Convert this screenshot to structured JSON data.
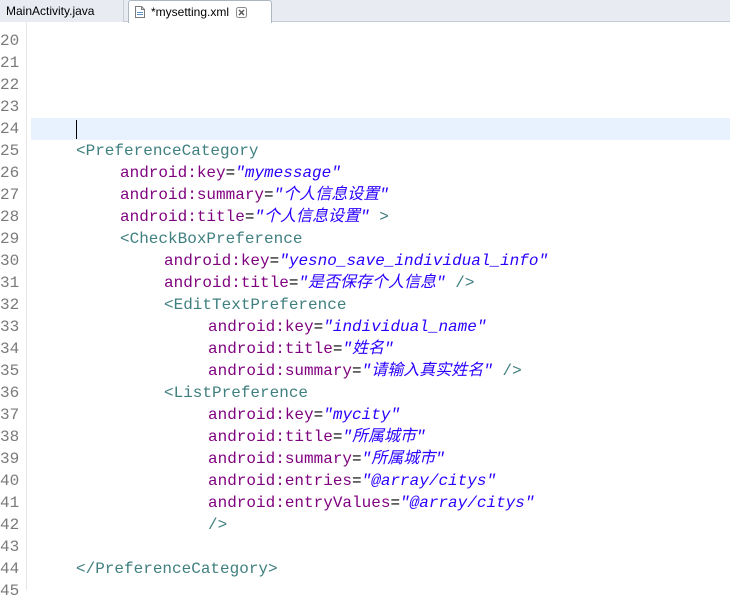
{
  "tabs": [
    {
      "label": "MainActivity.java"
    },
    {
      "label": "*mysetting.xml"
    }
  ],
  "lines": [
    {
      "n": "20",
      "indent": 0,
      "parts": []
    },
    {
      "n": "21",
      "indent": 0,
      "parts": []
    },
    {
      "n": "22",
      "indent": 0,
      "parts": []
    },
    {
      "n": "23",
      "indent": 0,
      "parts": []
    },
    {
      "n": "24",
      "indent": 0,
      "parts": [],
      "current": true
    },
    {
      "n": "25",
      "indent": 1,
      "parts": [
        [
          "tag",
          "<PreferenceCategory"
        ]
      ]
    },
    {
      "n": "26",
      "indent": 2,
      "parts": [
        [
          "attr",
          "android:key"
        ],
        [
          "eq",
          "="
        ],
        [
          "val",
          "\"mymessage\""
        ]
      ]
    },
    {
      "n": "27",
      "indent": 2,
      "parts": [
        [
          "attr",
          "android:summary"
        ],
        [
          "eq",
          "="
        ],
        [
          "val",
          "\"个人信息设置\""
        ]
      ]
    },
    {
      "n": "28",
      "indent": 2,
      "parts": [
        [
          "attr",
          "android:title"
        ],
        [
          "eq",
          "="
        ],
        [
          "val",
          "\"个人信息设置\""
        ],
        [
          "tag",
          " >"
        ]
      ]
    },
    {
      "n": "29",
      "indent": 2,
      "parts": [
        [
          "tag",
          "<CheckBoxPreference"
        ]
      ]
    },
    {
      "n": "30",
      "indent": 3,
      "parts": [
        [
          "attr",
          "android:key"
        ],
        [
          "eq",
          "="
        ],
        [
          "val",
          "\"yesno_save_individual_info\""
        ]
      ]
    },
    {
      "n": "31",
      "indent": 3,
      "parts": [
        [
          "attr",
          "android:title"
        ],
        [
          "eq",
          "="
        ],
        [
          "val",
          "\"是否保存个人信息\""
        ],
        [
          "tag",
          " />"
        ]
      ]
    },
    {
      "n": "32",
      "indent": 3,
      "parts": [
        [
          "tag",
          "<EditTextPreference"
        ]
      ]
    },
    {
      "n": "33",
      "indent": 4,
      "parts": [
        [
          "attr",
          "android:key"
        ],
        [
          "eq",
          "="
        ],
        [
          "val",
          "\"individual_name\""
        ]
      ]
    },
    {
      "n": "34",
      "indent": 4,
      "parts": [
        [
          "attr",
          "android:title"
        ],
        [
          "eq",
          "="
        ],
        [
          "val",
          "\"姓名\""
        ]
      ]
    },
    {
      "n": "35",
      "indent": 4,
      "parts": [
        [
          "attr",
          "android:summary"
        ],
        [
          "eq",
          "="
        ],
        [
          "val",
          "\"请输入真实姓名\""
        ],
        [
          "tag",
          " />"
        ]
      ]
    },
    {
      "n": "36",
      "indent": 3,
      "parts": [
        [
          "tag",
          "<ListPreference"
        ]
      ]
    },
    {
      "n": "37",
      "indent": 4,
      "parts": [
        [
          "attr",
          "android:key"
        ],
        [
          "eq",
          "="
        ],
        [
          "val",
          "\"mycity\""
        ]
      ]
    },
    {
      "n": "38",
      "indent": 4,
      "parts": [
        [
          "attr",
          "android:title"
        ],
        [
          "eq",
          "="
        ],
        [
          "val",
          "\"所属城市\""
        ]
      ]
    },
    {
      "n": "39",
      "indent": 4,
      "parts": [
        [
          "attr",
          "android:summary"
        ],
        [
          "eq",
          "="
        ],
        [
          "val",
          "\"所属城市\""
        ]
      ]
    },
    {
      "n": "40",
      "indent": 4,
      "parts": [
        [
          "attr",
          "android:entries"
        ],
        [
          "eq",
          "="
        ],
        [
          "val",
          "\"@array/citys\""
        ]
      ]
    },
    {
      "n": "41",
      "indent": 4,
      "parts": [
        [
          "attr",
          "android:entryValues"
        ],
        [
          "eq",
          "="
        ],
        [
          "val",
          "\"@array/citys\""
        ]
      ]
    },
    {
      "n": "42",
      "indent": 4,
      "parts": [
        [
          "tag",
          "/>"
        ]
      ]
    },
    {
      "n": "43",
      "indent": 0,
      "parts": []
    },
    {
      "n": "44",
      "indent": 1,
      "parts": [
        [
          "tag",
          "</PreferenceCategory>"
        ]
      ]
    },
    {
      "n": "45",
      "indent": 0,
      "parts": []
    }
  ],
  "colors": {
    "tag": "#3f7f7f",
    "attribute": "#7f007f",
    "value": "#2a00ff",
    "current_line": "#e8f2fe"
  }
}
